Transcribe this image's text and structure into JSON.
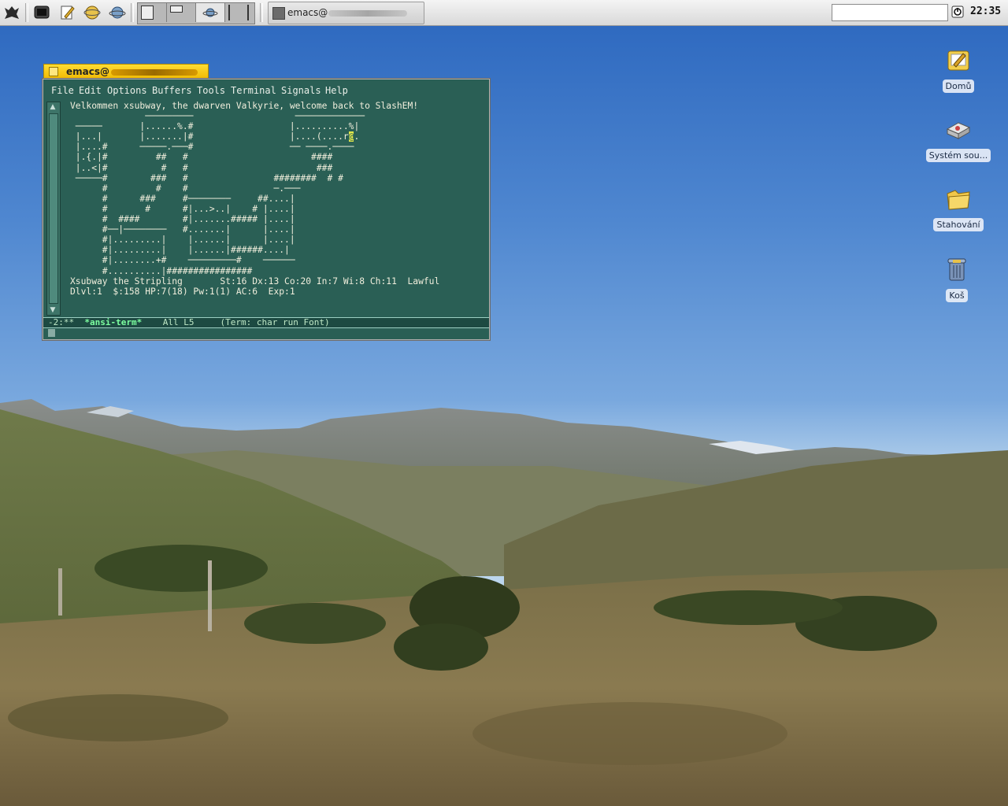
{
  "panel": {
    "launchers": [
      {
        "icon": "app-menu-icon"
      },
      {
        "icon": "terminal-icon"
      },
      {
        "icon": "text-editor-icon"
      },
      {
        "icon": "web-browser-icon"
      },
      {
        "icon": "email-icon"
      }
    ],
    "pager_workspaces": 4,
    "active_workspace": 3,
    "task": {
      "label": "emacs@",
      "icon": "window-icon"
    },
    "search_value": "",
    "clock": "22:35"
  },
  "desktop": {
    "icons": [
      {
        "label": "Domů",
        "icon": "home-folder-icon"
      },
      {
        "label": "Systém sou...",
        "icon": "filesystem-drive-icon"
      },
      {
        "label": "Stahování",
        "icon": "downloads-folder-icon"
      },
      {
        "label": "Koš",
        "icon": "trash-icon"
      }
    ]
  },
  "emacs": {
    "title": "emacs@",
    "menu": [
      "File",
      "Edit",
      "Options",
      "Buffers",
      "Tools",
      "Terminal",
      "Signals",
      "Help"
    ],
    "terminal_lines": [
      "Velkommen xsubway, the dwarven Valkyrie, welcome back to SlashEM!",
      "",
      "              ─────────                   ─────────────",
      " ─────       |......%.#                  |..........%|",
      " |...|       |.......|#                  |....(....r",
      " |....#      ─────.───#                  ── ────.────",
      " |.{.|#         ##   #                       ####",
      " |..<|#          #   #                        ###",
      " ─────#        ###   #                ########  # #",
      "      #         #    #                ─.───",
      "      #      ###     #────────     ##....|",
      "      #       #      #|...>..|    # |....|",
      "      #  ####        #|.......##### |....|",
      "      #──|────────   #.......|      |....|",
      "      #|.........|    |......|      |....|",
      "      #|.........|    |......|######....|",
      "      #|........+#    ─────────#    ──────",
      "      #..........|################",
      "Xsubway the Stripling       St:16 Dx:13 Co:20 In:7 Wi:8 Ch:11  Lawful",
      "Dlvl:1  $:158 HP:7(18) Pw:1(1) AC:6  Exp:1"
    ],
    "cursor_glyph": "@",
    "cursor_tail": ".",
    "modeline": {
      "prefix": "-2:**  ",
      "buffer": "*ansi-term*",
      "rest": "    All L5     (Term: char run Font)"
    }
  }
}
